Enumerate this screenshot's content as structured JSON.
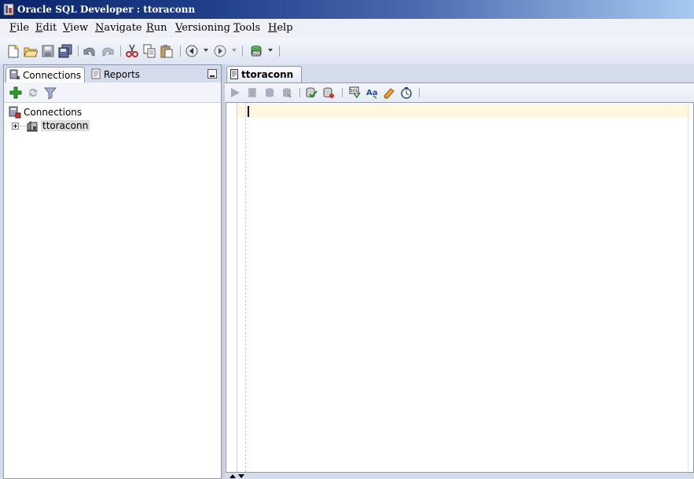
{
  "window": {
    "title": "Oracle SQL Developer : ttoraconn"
  },
  "menu": [
    {
      "label": "File",
      "mnemonic": "F",
      "rest": "ile"
    },
    {
      "label": "Edit",
      "mnemonic": "E",
      "rest": "dit"
    },
    {
      "label": "View",
      "mnemonic": "V",
      "rest": "iew"
    },
    {
      "label": "Navigate",
      "mnemonic": "N",
      "rest": "avigate"
    },
    {
      "label": "Run",
      "mnemonic": "R",
      "rest": "un"
    },
    {
      "label": "Versioning",
      "mnemonic": "V",
      "rest": "ersioning"
    },
    {
      "label": "Tools",
      "mnemonic": "T",
      "rest": "ools"
    },
    {
      "label": "Help",
      "mnemonic": "H",
      "rest": "elp"
    }
  ],
  "toolbar": {
    "buttons": [
      "new-icon",
      "open-icon",
      "save-icon",
      "save-all-icon",
      "undo-icon",
      "redo-icon",
      "cut-icon",
      "copy-icon",
      "paste-icon",
      "back-icon",
      "forward-icon",
      "sql-worksheet-icon"
    ]
  },
  "left_panel": {
    "tabs": [
      {
        "label": "Connections",
        "active": true
      },
      {
        "label": "Reports",
        "active": false
      }
    ],
    "tree": {
      "root": "Connections",
      "children": [
        {
          "label": "ttoraconn",
          "selected": true,
          "expanded": false
        }
      ]
    }
  },
  "editor": {
    "tab_label": "ttoraconn",
    "content": ""
  },
  "colors": {
    "title_bar_start": "#0a246a",
    "title_bar_end": "#a6caf0",
    "chrome": "#d4dbea",
    "current_line": "#fff8dc",
    "add_icon": "#2aa02a"
  }
}
